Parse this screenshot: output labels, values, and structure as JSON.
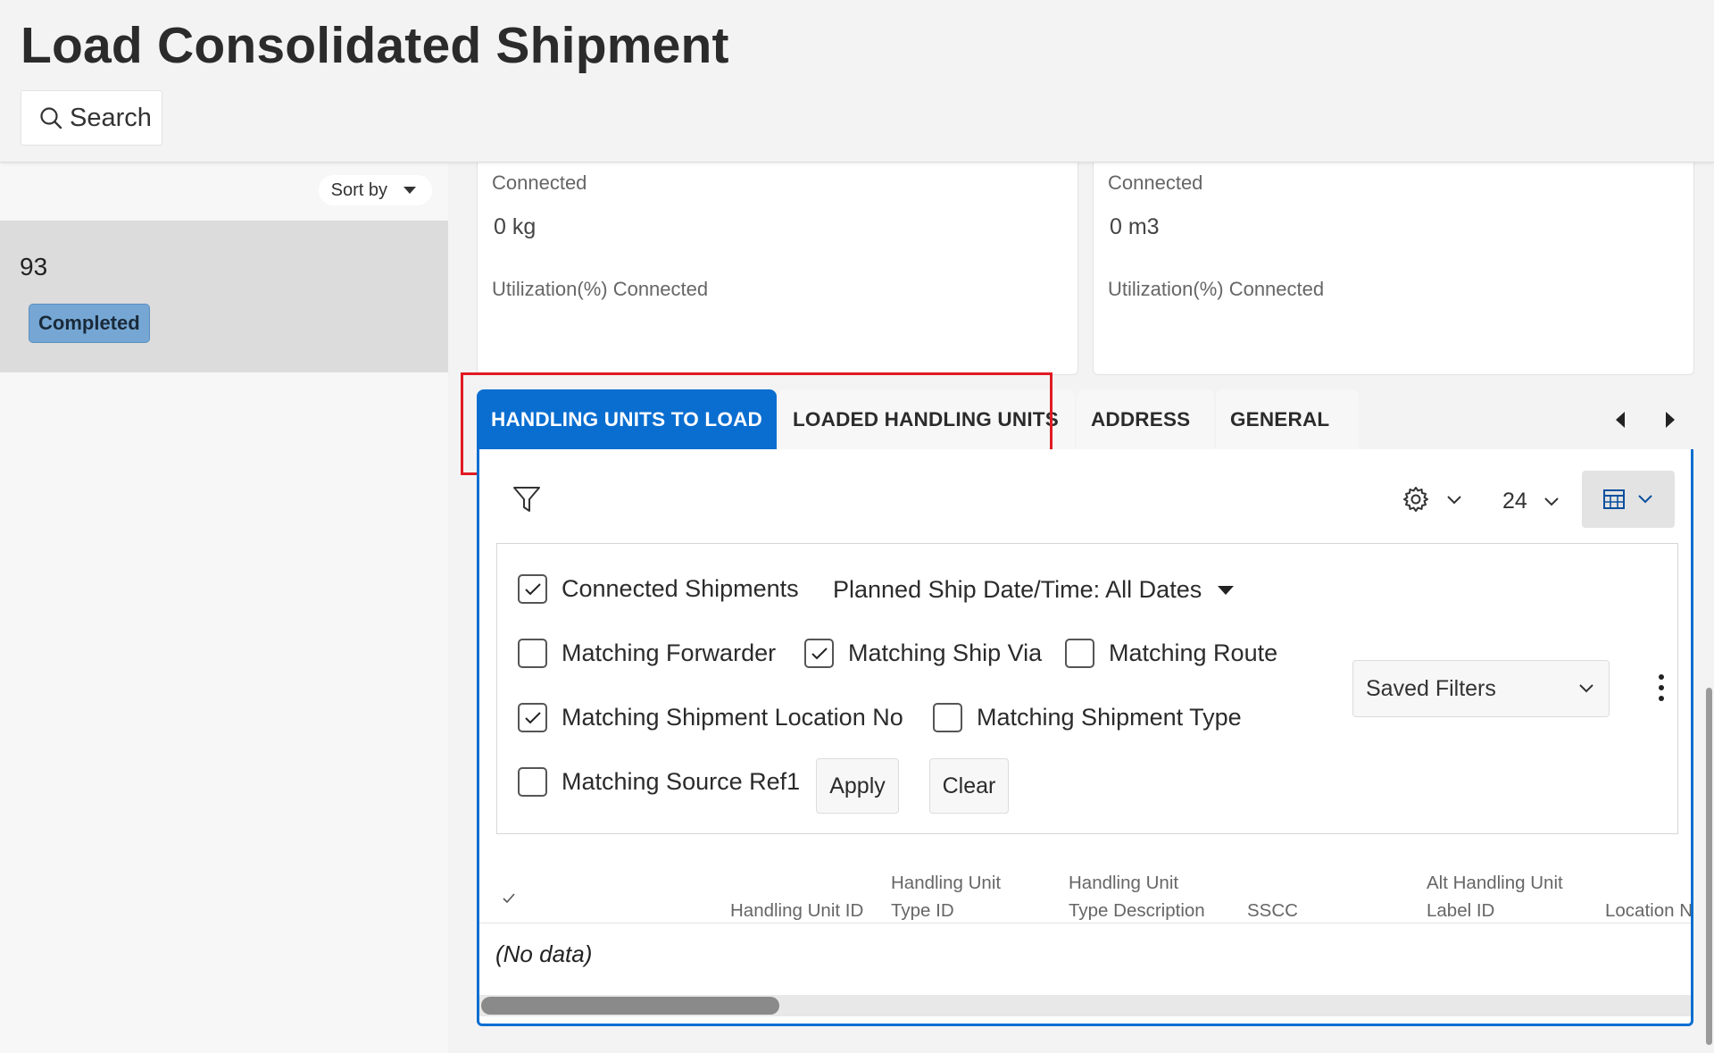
{
  "header": {
    "title": "Load Consolidated Shipment",
    "search_label": "Search"
  },
  "sidebar": {
    "sort_label": "Sort by",
    "items": [
      {
        "number": "93",
        "status": "Completed"
      }
    ]
  },
  "cards": [
    {
      "label_top": "Connected",
      "value": "0 kg",
      "label_bottom": "Utilization(%) Connected"
    },
    {
      "label_top": "Connected",
      "value": "0 m3",
      "label_bottom": "Utilization(%) Connected"
    }
  ],
  "tabs": [
    {
      "label": "HANDLING UNITS TO LOAD",
      "active": true
    },
    {
      "label": "LOADED HANDLING UNITS",
      "active": false
    },
    {
      "label": "ADDRESS",
      "active": false
    },
    {
      "label": "GENERAL",
      "active": false
    }
  ],
  "toolbar": {
    "page_size": "24"
  },
  "filters": {
    "connected_shipments": {
      "label": "Connected Shipments",
      "checked": true
    },
    "planned_ship_date": "Planned Ship Date/Time: All Dates",
    "matching_forwarder": {
      "label": "Matching Forwarder",
      "checked": false
    },
    "matching_ship_via": {
      "label": "Matching Ship Via",
      "checked": true
    },
    "matching_route": {
      "label": "Matching Route",
      "checked": false
    },
    "matching_shipment_location_no": {
      "label": "Matching Shipment Location No",
      "checked": true
    },
    "matching_shipment_type": {
      "label": "Matching Shipment Type",
      "checked": false
    },
    "matching_source_ref1": {
      "label": "Matching Source Ref1",
      "checked": false
    },
    "apply_label": "Apply",
    "clear_label": "Clear",
    "saved_filters_label": "Saved Filters"
  },
  "table": {
    "columns": [
      {
        "line1": "",
        "line2": "Handling Unit ID"
      },
      {
        "line1": "Handling Unit",
        "line2": "Type ID"
      },
      {
        "line1": "Handling Unit",
        "line2": "Type Description"
      },
      {
        "line1": "",
        "line2": "SSCC"
      },
      {
        "line1": "Alt Handling Unit",
        "line2": "Label ID"
      },
      {
        "line1": "",
        "line2": "Location N"
      }
    ],
    "empty_text": "(No data)"
  },
  "colors": {
    "accent": "#0a6ed1",
    "highlight": "#e01a22",
    "badge": "#76a7d4"
  }
}
